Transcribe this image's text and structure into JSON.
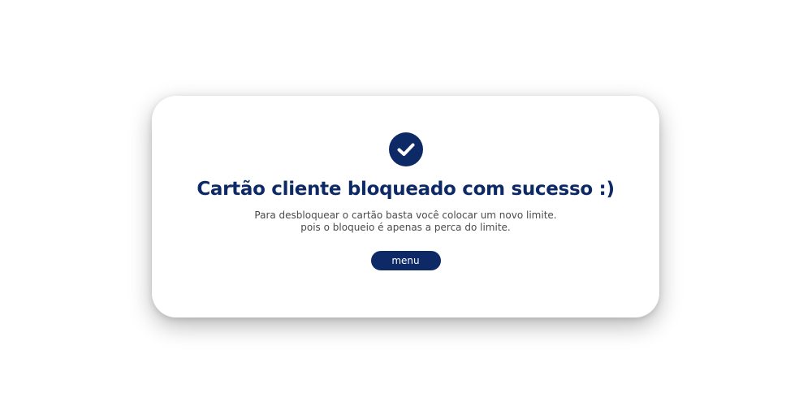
{
  "colors": {
    "primary": "#0d2a66",
    "text_muted": "#4a4a4a",
    "card_background": "#ffffff"
  },
  "dialog": {
    "icon": "check-circle-icon",
    "title": "Cartão cliente bloqueado com sucesso :)",
    "message_line_1": "Para desbloquear o cartão basta você colocar um novo limite.",
    "message_line_2": "pois o bloqueio é apenas a perca do limite.",
    "menu_label": "menu"
  }
}
